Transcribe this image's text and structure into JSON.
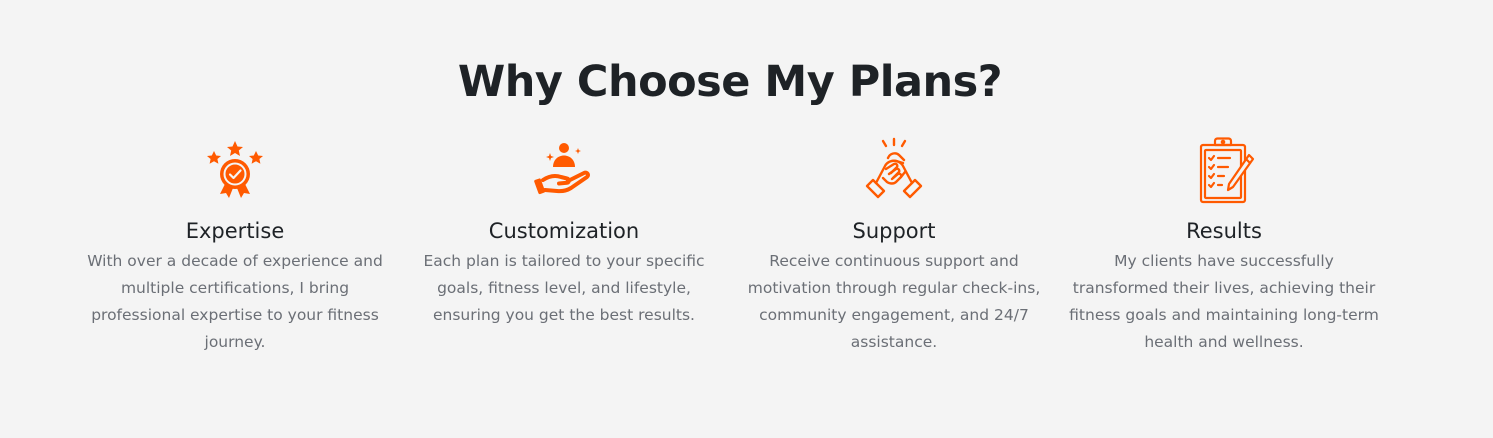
{
  "section": {
    "heading": "Why Choose My Plans?"
  },
  "accent_color": "#ff5a00",
  "features": [
    {
      "icon": "award-medal-stars-icon",
      "title": "Expertise",
      "description": "With over a decade of experience and multiple certifications, I bring professional expertise to your fitness journey."
    },
    {
      "icon": "hand-offering-person-icon",
      "title": "Customization",
      "description": "Each plan is tailored to your specific goals, fitness level, and lifestyle, ensuring you get the best results."
    },
    {
      "icon": "handshake-clasp-icon",
      "title": "Support",
      "description": "Receive continuous support and motivation through regular check-ins, community engagement, and 24/7 assistance."
    },
    {
      "icon": "clipboard-checklist-pencil-icon",
      "title": "Results",
      "description": "My clients have successfully transformed their lives, achieving their fitness goals and maintaining long-term health and wellness."
    }
  ]
}
